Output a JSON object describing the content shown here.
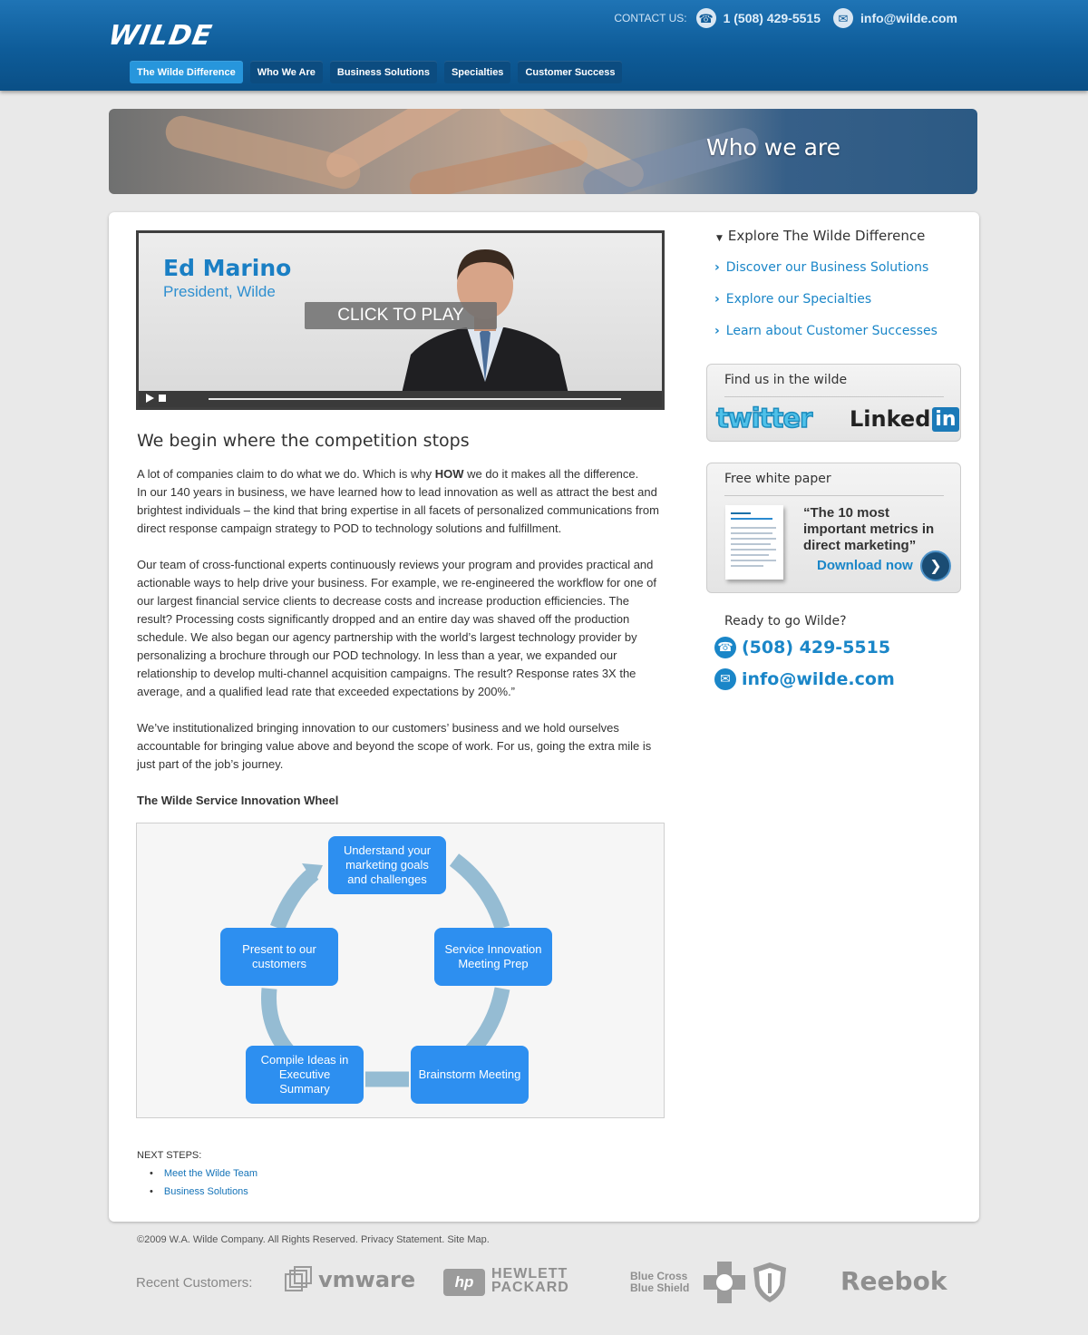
{
  "header": {
    "logo": "WILDE",
    "contact_label": "CONTACT US:",
    "phone": "1 (508) 429-5515",
    "email": "info@wilde.com",
    "phone_icon": "phone-icon",
    "email_icon": "email-icon",
    "nav": [
      {
        "label": "The Wilde Difference",
        "active": true
      },
      {
        "label": "Who We Are",
        "active": false
      },
      {
        "label": "Business Solutions",
        "active": false
      },
      {
        "label": "Specialties",
        "active": false
      },
      {
        "label": "Customer Success",
        "active": false
      }
    ]
  },
  "banner": {
    "title": "Who we are"
  },
  "video": {
    "name": "Ed Marino",
    "role": "President, Wilde",
    "overlay": "CLICK TO PLAY"
  },
  "main": {
    "heading": "We begin where the competition stops",
    "p1_a": "A lot of companies claim to do what we do. Which is why ",
    "p1_bold": "HOW",
    "p1_b": " we do it makes all the difference.",
    "p1_c": "In our 140 years in business, we have learned how to lead innovation as well as attract the best and brightest individuals – the kind that bring expertise in all facets of personalized communications from direct response campaign strategy to POD to technology solutions and fulfillment.",
    "p2": "Our team of cross-functional experts continuously reviews your program and provides practical and actionable ways to help drive your business. For example, we re-engineered the workflow for one of our largest financial service clients to decrease costs and increase production efficiencies. The result? Processing costs significantly dropped and an entire day was shaved off the production schedule. We also began our agency partnership with the world’s largest technology provider by personalizing a brochure through our POD technology. In less than a year, we expanded our relationship to develop multi-channel acquisition campaigns. The result? Response rates 3X the average, and a qualified lead rate that exceeded expectations by 200%.”",
    "p3": "We’ve institutionalized bringing innovation to our customers’ business and we hold ourselves accountable for bringing value above and beyond the scope of work.  For us, going the extra mile is just part of the job’s journey.",
    "wheel_title": "The Wilde Service Innovation Wheel",
    "wheel": {
      "top": "Understand your marketing goals and challenges",
      "right": "Service Innovation Meeting Prep",
      "bottom_right": "Brainstorm Meeting",
      "bottom_left": "Compile Ideas in Executive Summary",
      "left": "Present to our customers"
    },
    "next_steps_label": "NEXT STEPS:",
    "next_steps": [
      "Meet the Wilde Team",
      "Business Solutions"
    ]
  },
  "sidebar": {
    "explore_heading": "Explore The Wilde Difference",
    "links": [
      "Discover our Business Solutions",
      "Explore our Specialties",
      "Learn about Customer Successes"
    ],
    "social_title": "Find us in the wilde",
    "twitter": "twitter",
    "linkedin_a": "Linked",
    "linkedin_b": "in",
    "paper_title": "Free white paper",
    "paper_quote": "“The 10 most important metrics in direct marketing”",
    "paper_download": "Download now",
    "ready_title": "Ready to go Wilde?",
    "ready_phone": "(508) 429-5515",
    "ready_email": "info@wilde.com"
  },
  "footer": {
    "copyright": "©2009 W.A. Wilde Company. All Rights Reserved. Privacy Statement. Site Map.",
    "recent_label": "Recent Customers:",
    "vmware": "vmware",
    "hp_badge": "hp",
    "hp_line1": "HEWLETT",
    "hp_line2": "PACKARD",
    "bcbs_line1": "Blue Cross",
    "bcbs_line2": "Blue Shield",
    "reebok": "Reebok"
  }
}
